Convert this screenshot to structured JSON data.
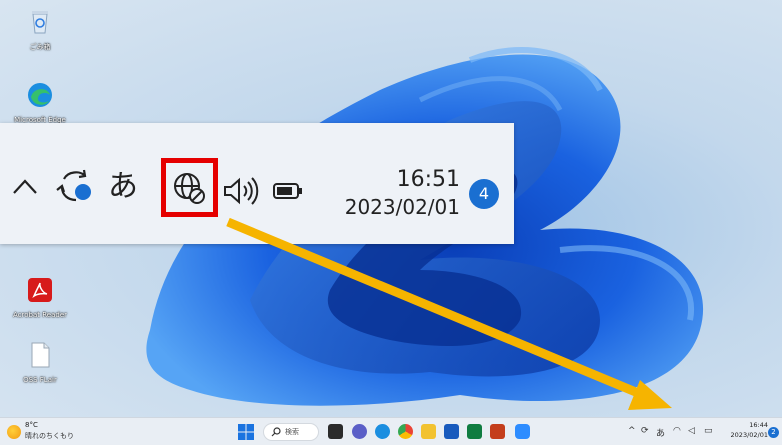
{
  "desktop": {
    "icons": [
      {
        "label": "ごみ箱"
      },
      {
        "label": "Microsoft Edge"
      },
      {
        "label": "Acrobat Reader"
      },
      {
        "label": "OSS FLair"
      }
    ]
  },
  "zoom": {
    "ime_label": "あ",
    "time": "16:51",
    "date": "2023/02/01",
    "notification_count": "4"
  },
  "taskbar": {
    "weather": {
      "temp": "8°C",
      "condition": "晴れのちくもり"
    },
    "search_label": "検索",
    "tray": {
      "ime_label": "あ",
      "time": "16:44",
      "date": "2023/02/01",
      "notification_count": "2"
    }
  },
  "colors": {
    "highlight": "#e50000",
    "arrow": "#f6b400",
    "accent": "#1a6fd1"
  }
}
